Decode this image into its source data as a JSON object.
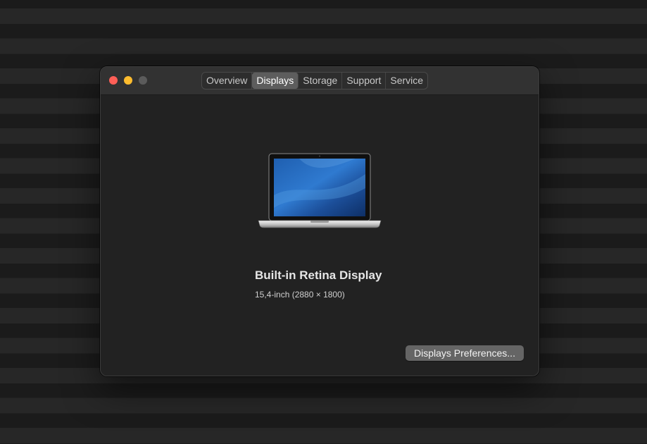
{
  "window": {
    "traffic_lights": {
      "close": "#ff5f57",
      "minimize": "#febc2e",
      "zoom": "#5b5b5b"
    }
  },
  "tabs": [
    {
      "label": "Overview",
      "active": false
    },
    {
      "label": "Displays",
      "active": true
    },
    {
      "label": "Storage",
      "active": false
    },
    {
      "label": "Support",
      "active": false
    },
    {
      "label": "Service",
      "active": false
    }
  ],
  "display": {
    "icon": "macbook-pro-laptop-icon",
    "name": "Built-in Retina Display",
    "size": "15,4-inch (2880 × 1800)"
  },
  "buttons": {
    "preferences_label": "Displays Preferences..."
  }
}
